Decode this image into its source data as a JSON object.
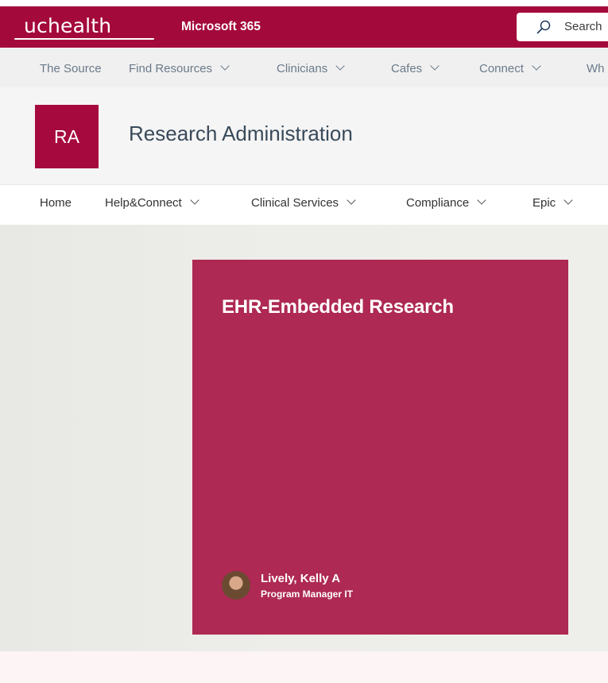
{
  "suite_bar": {
    "logo_text": "uchealth",
    "app_name": "Microsoft 365",
    "search_label": "Search",
    "background": "#a4093c"
  },
  "hub_nav": {
    "items": [
      {
        "label": "The Source"
      },
      {
        "label": "Find Resources"
      },
      {
        "label": "Clinicians"
      },
      {
        "label": "Cafes"
      },
      {
        "label": "Connect"
      },
      {
        "label": "Wh"
      }
    ]
  },
  "site_header": {
    "icon_text": "RA",
    "title": "Research Administration",
    "icon_color": "#a6093d"
  },
  "site_nav": {
    "items": [
      {
        "label": "Home"
      },
      {
        "label": "Help&Connect"
      },
      {
        "label": "Clinical Services"
      },
      {
        "label": "Compliance"
      },
      {
        "label": "Epic"
      }
    ]
  },
  "hero": {
    "title": "EHR-Embedded Research",
    "author": {
      "name": "Lively, Kelly A",
      "role": "Program Manager IT"
    },
    "card_color": "#ae2953"
  }
}
